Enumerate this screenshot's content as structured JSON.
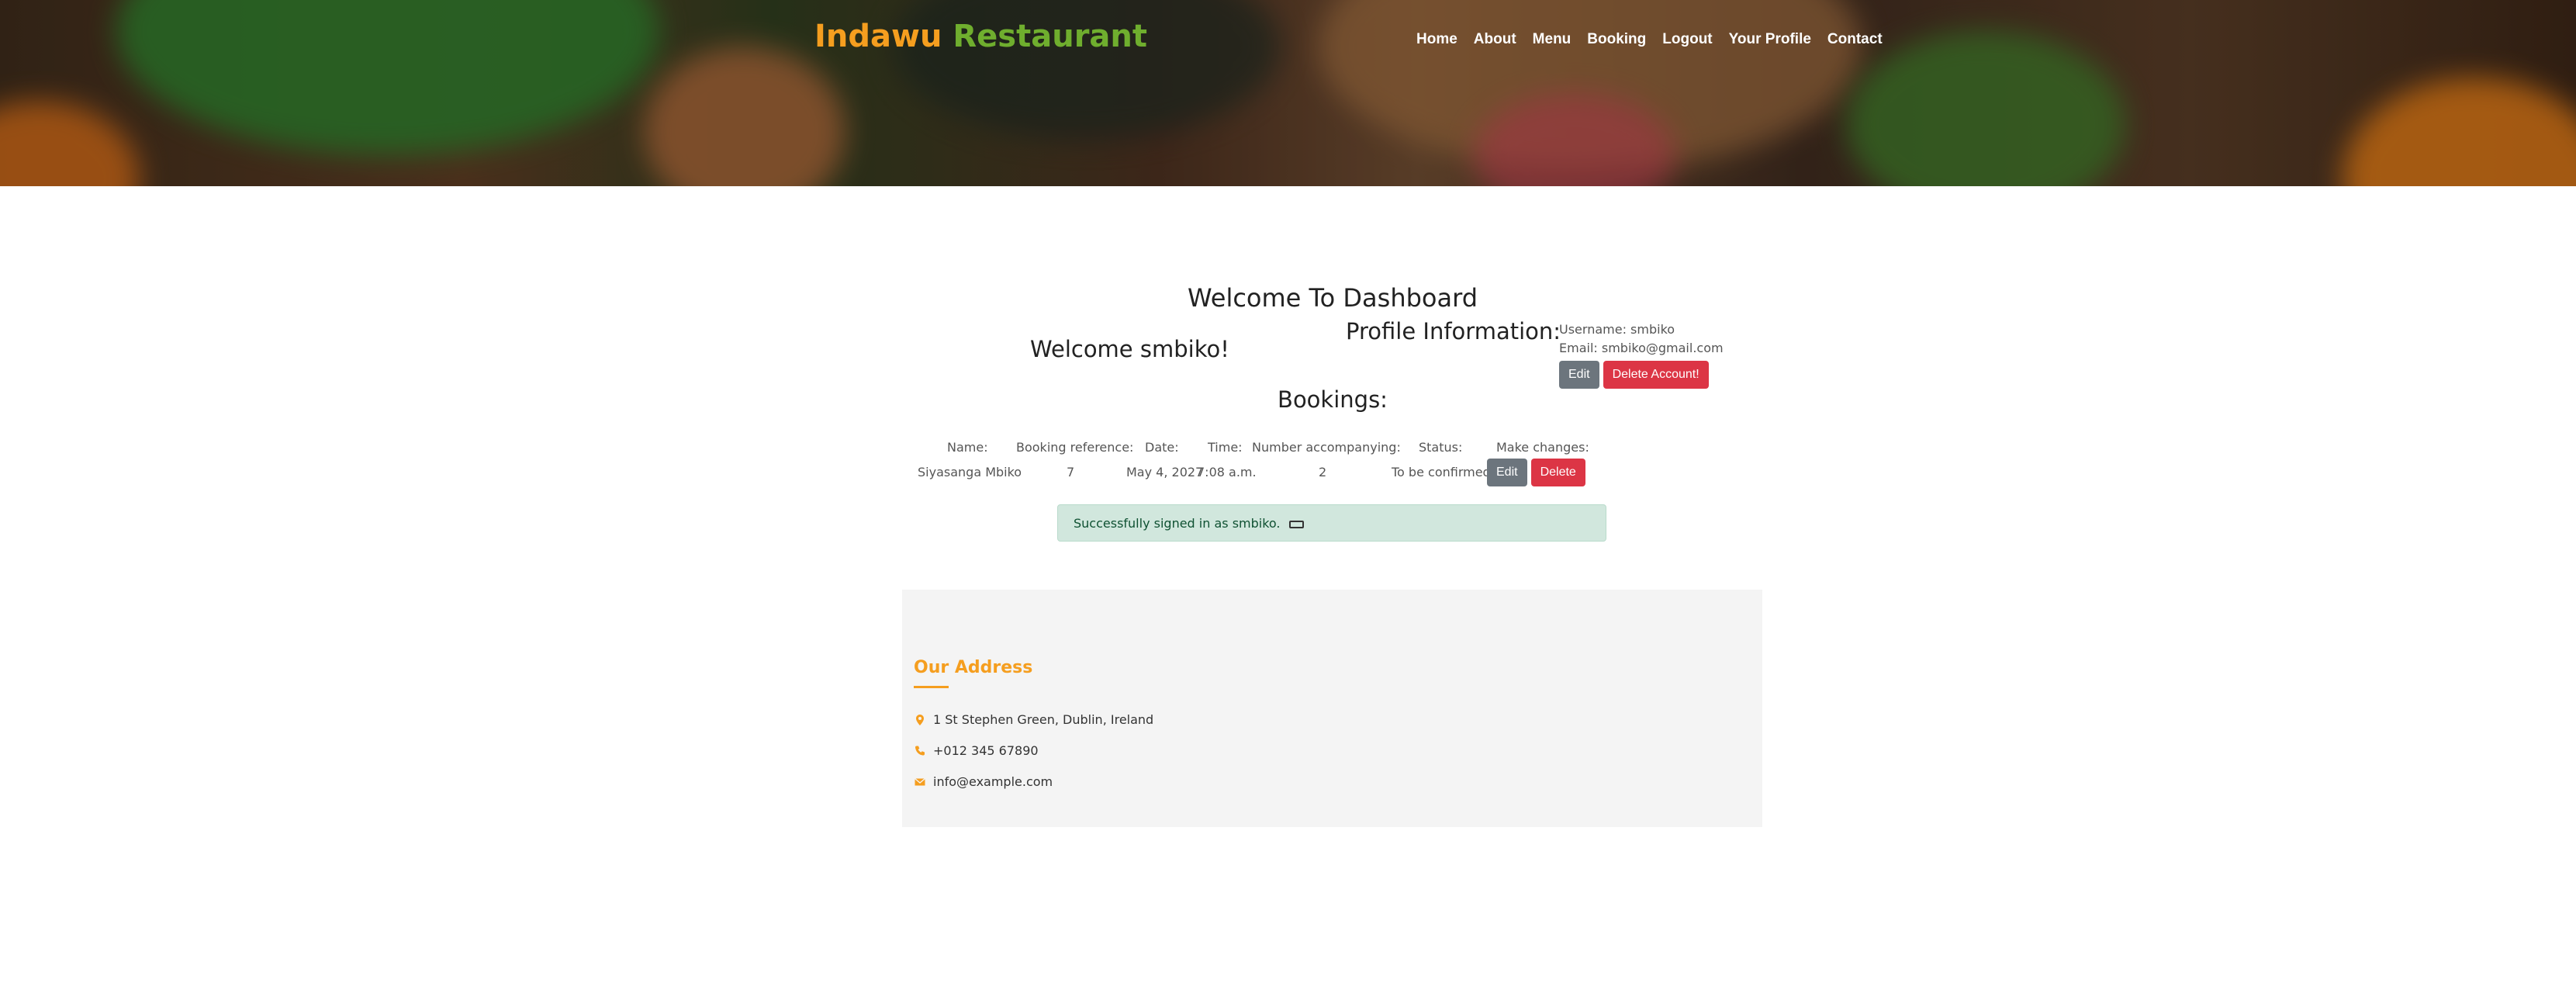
{
  "brand": {
    "part1": "Indawu",
    "part2": "Restaurant"
  },
  "nav": [
    {
      "label": "Home",
      "name": "nav-home"
    },
    {
      "label": "About",
      "name": "nav-about"
    },
    {
      "label": "Menu",
      "name": "nav-menu"
    },
    {
      "label": "Booking",
      "name": "nav-booking"
    },
    {
      "label": "Logout",
      "name": "nav-logout"
    },
    {
      "label": "Your Profile",
      "name": "nav-your-profile"
    },
    {
      "label": "Contact",
      "name": "nav-contact"
    }
  ],
  "dashboard": {
    "title": "Welcome To Dashboard",
    "welcome": "Welcome smbiko!"
  },
  "profile": {
    "title": "Profile Information:",
    "username": "Username: smbiko",
    "email": "Email: smbiko@gmail.com",
    "edit_label": "Edit",
    "delete_label": "Delete Account!"
  },
  "bookings": {
    "title": "Bookings:",
    "headers": [
      "Name:",
      "Booking reference:",
      "Date:",
      "Time:",
      "Number accompanying:",
      "Status:",
      "Make changes:"
    ],
    "rows": [
      {
        "name": "Siyasanga Mbiko",
        "reference": "7",
        "date": "May 4, 2027",
        "time": "7:08 a.m.",
        "accompanying": "2",
        "status": "To be confirmed",
        "edit_label": "Edit",
        "delete_label": "Delete"
      }
    ]
  },
  "alert": {
    "message": "Successfully signed in as smbiko."
  },
  "footer": {
    "title": "Our Address",
    "address": "1 St Stephen Green, Dublin, Ireland",
    "phone": "+012 345 67890",
    "email": "info@example.com"
  },
  "colors": {
    "brand_orange": "#f59e1f",
    "brand_green": "#6fae2e",
    "button_gray": "#6c757d",
    "button_red": "#dc3545",
    "alert_bg": "#d1e7dd"
  }
}
